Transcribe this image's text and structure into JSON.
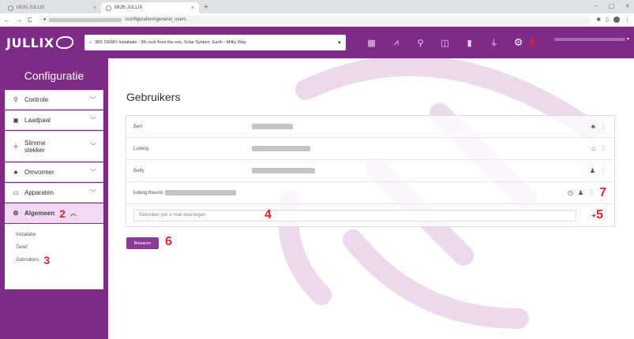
{
  "browser": {
    "tabs": [
      {
        "title": "MIJN JULLIX",
        "active": false
      },
      {
        "title": "MIJN JULLIX",
        "active": true
      }
    ],
    "new_tab": "+",
    "window_controls": [
      "–",
      "▢",
      "×"
    ],
    "nav": {
      "back": "←",
      "forward": "→",
      "reload": "C"
    },
    "url_suffix": "/configuration#general_users"
  },
  "header": {
    "logo_text": "JULLIX",
    "location": "383: DEMO Installatie - 3th rock from the sun, Solar System, Earth - Milky Way",
    "nav_icons": [
      "dashboard-icon",
      "chart-icon",
      "search-icon",
      "battery-icon",
      "device-icon",
      "plug-icon",
      "gear-icon"
    ],
    "annotation": "1"
  },
  "sidebar": {
    "title": "Configuratie",
    "items": [
      {
        "label": "Controle",
        "icon": "search-icon"
      },
      {
        "label": "Laadpaal",
        "icon": "charger-icon"
      },
      {
        "label": "Slimme stekker",
        "icon": "plug-icon"
      },
      {
        "label": "Omvormer",
        "icon": "inverter-icon"
      },
      {
        "label": "Apparaten",
        "icon": "appliance-icon"
      },
      {
        "label": "Algemeen",
        "icon": "gear-icon",
        "active": true,
        "annotation": "2"
      }
    ],
    "submenu": [
      {
        "label": "Installatie"
      },
      {
        "label": "Tarief"
      },
      {
        "label": "Gebruikers",
        "annotation": "3"
      }
    ]
  },
  "main": {
    "title": "Gebruikers",
    "users": [
      {
        "name": "Bert",
        "email_blur_width": 52
      },
      {
        "name": "Ludwig",
        "email_blur_width": 74
      },
      {
        "name": "Betty",
        "email_blur_width": 80
      },
      {
        "name": "ludwig.theunis",
        "email_blur_width": 0,
        "annotation": "7"
      }
    ],
    "add_placeholder": "Gebruiker per e-mail toevoegen",
    "add_annotation": "4",
    "plus_label": "+",
    "plus_annotation": "5",
    "save_label": "Bewaren",
    "save_annotation": "6"
  },
  "colors": {
    "brand": "#7e2a86",
    "accent": "#8a3a92",
    "annotation": "#e8202a"
  }
}
